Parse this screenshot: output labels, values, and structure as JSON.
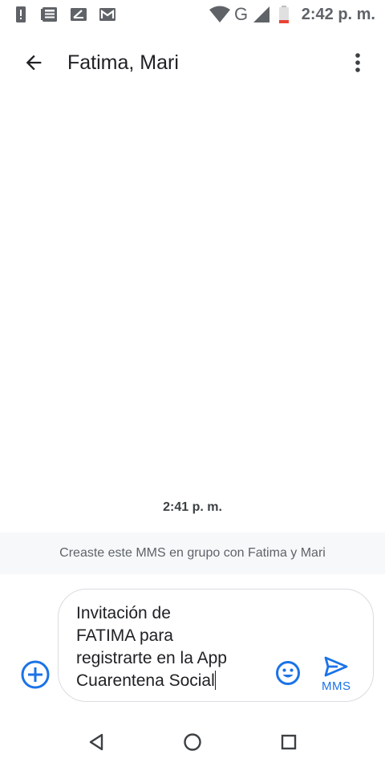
{
  "status_bar": {
    "time": "2:42 p. m.",
    "network_label": "G",
    "icons": [
      "alert-icon",
      "news-icon",
      "sim-card-icon",
      "gmail-icon",
      "wifi-icon",
      "signal-icon",
      "battery-low-icon"
    ]
  },
  "app_bar": {
    "title": "Fatima, Mari",
    "back_icon": "arrow-back-icon",
    "menu_icon": "more-vert-icon"
  },
  "conversation": {
    "timestamp": "2:41 p. m.",
    "group_info": "Creaste este MMS en grupo con Fatima y Mari"
  },
  "compose": {
    "message_text": "Invitación de\nFATIMA para\nregistrarte en la App\nCuarentena Social",
    "send_label": "MMS",
    "add_icon": "add-circle-icon",
    "emoji_icon": "emoji-icon",
    "send_icon": "send-icon"
  },
  "nav_bar": {
    "icons": [
      "back-triangle-icon",
      "home-circle-icon",
      "recents-square-icon"
    ]
  },
  "colors": {
    "accent": "#1a73e8",
    "text_primary": "#202124",
    "text_secondary": "#5f6368",
    "banner_bg": "#f7f8fa",
    "battery_low": "#ea4335"
  }
}
